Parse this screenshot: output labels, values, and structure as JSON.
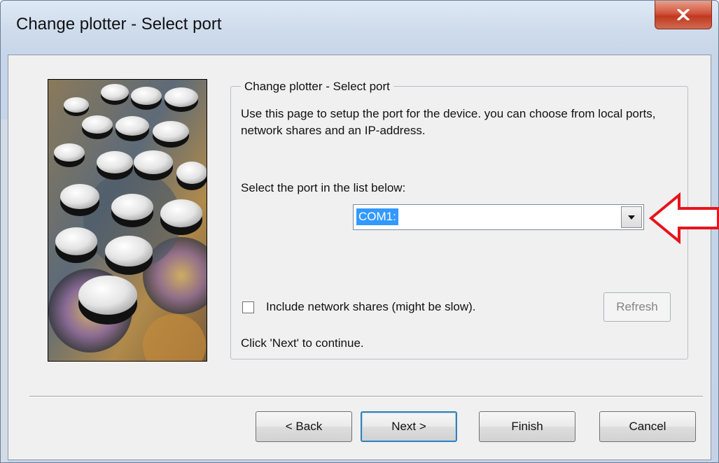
{
  "window": {
    "title": "Change plotter - Select port"
  },
  "group": {
    "legend": "Change plotter - Select port",
    "description": "Use this page to setup the port for the device. you can choose from local ports, network shares and an IP-address.",
    "select_label": "Select the port in the list below:"
  },
  "port_combo": {
    "selected_value": "COM1:"
  },
  "network_shares": {
    "label": "Include network shares (might be slow).",
    "checked": false
  },
  "refresh_label": "Refresh",
  "hint": "Click 'Next' to continue.",
  "buttons": {
    "back": "< Back",
    "next": "Next >",
    "finish": "Finish",
    "cancel": "Cancel"
  },
  "colors": {
    "selection": "#3399ff",
    "annotation_arrow": "#e8141b",
    "close_button": "#c8452c"
  },
  "icons": {
    "close": "close-icon",
    "dropdown": "chevron-down-icon",
    "annotation": "left-arrow-annotation"
  }
}
